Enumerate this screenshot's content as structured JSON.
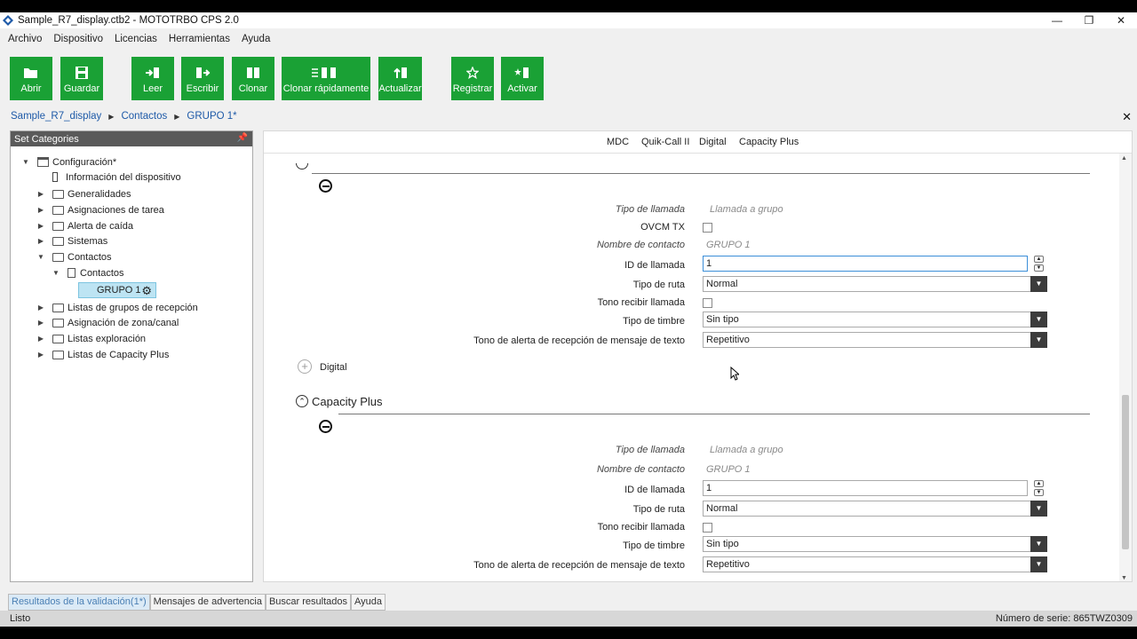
{
  "window": {
    "title": "Sample_R7_display.ctb2 - MOTOTRBO CPS 2.0"
  },
  "menu": [
    "Archivo",
    "Dispositivo",
    "Licencias",
    "Herramientas",
    "Ayuda"
  ],
  "toolbar": {
    "abrir": "Abrir",
    "guardar": "Guardar",
    "leer": "Leer",
    "escribir": "Escribir",
    "clonar": "Clonar",
    "clonar_rapido": "Clonar rápidamente",
    "actualizar": "Actualizar",
    "registrar": "Registrar",
    "activar": "Activar",
    "accent_color": "#1aa135"
  },
  "breadcrumb": [
    "Sample_R7_display",
    "Contactos",
    "GRUPO 1*"
  ],
  "left_panel": {
    "title": "Set Categories",
    "tree": {
      "configuracion": "Configuración*",
      "info_dispositivo": "Información del dispositivo",
      "generalidades": "Generalidades",
      "asignaciones_tarea": "Asignaciones de tarea",
      "alerta_caida": "Alerta de caída",
      "sistemas": "Sistemas",
      "contactos": "Contactos",
      "contactos_child": "Contactos",
      "grupo1": "GRUPO 1",
      "listas_grupos_recepcion": "Listas de grupos de recepción",
      "asignacion_zona": "Asignación de zona/canal",
      "listas_exploracion": "Listas exploración",
      "listas_capacity_plus": "Listas de Capacity Plus"
    }
  },
  "right_panel": {
    "tabs": [
      "MDC",
      "Quik-Call II",
      "Digital",
      "Capacity Plus"
    ],
    "labels": {
      "tipo_llamada": "Tipo de llamada",
      "ovcm_tx": "OVCM TX",
      "nombre_contacto": "Nombre de contacto",
      "id_llamada": "ID de llamada",
      "tipo_ruta": "Tipo de ruta",
      "tono_recibir": "Tono recibir llamada",
      "tipo_timbre": "Tipo de timbre",
      "tono_alerta": "Tono de alerta de recepción de mensaje de texto"
    },
    "digital_section": {
      "title": "Digital",
      "tipo_llamada_value": "Llamada a grupo",
      "nombre_contacto_value": "GRUPO 1",
      "id_llamada_value": "1",
      "tipo_ruta_value": "Normal",
      "tipo_timbre_value": "Sin tipo",
      "tono_alerta_value": "Repetitivo"
    },
    "capacity_section": {
      "title": "Capacity Plus",
      "tipo_llamada_value": "Llamada a grupo",
      "nombre_contacto_value": "GRUPO 1",
      "id_llamada_value": "1",
      "tipo_ruta_value": "Normal",
      "tipo_timbre_value": "Sin tipo",
      "tono_alerta_value": "Repetitivo"
    }
  },
  "bottom_tabs": [
    "Resultados de la validación(1*)",
    "Mensajes de advertencia",
    "Buscar resultados",
    "Ayuda"
  ],
  "status": {
    "left": "Listo",
    "right": "Número de serie: 865TWZ0309"
  }
}
